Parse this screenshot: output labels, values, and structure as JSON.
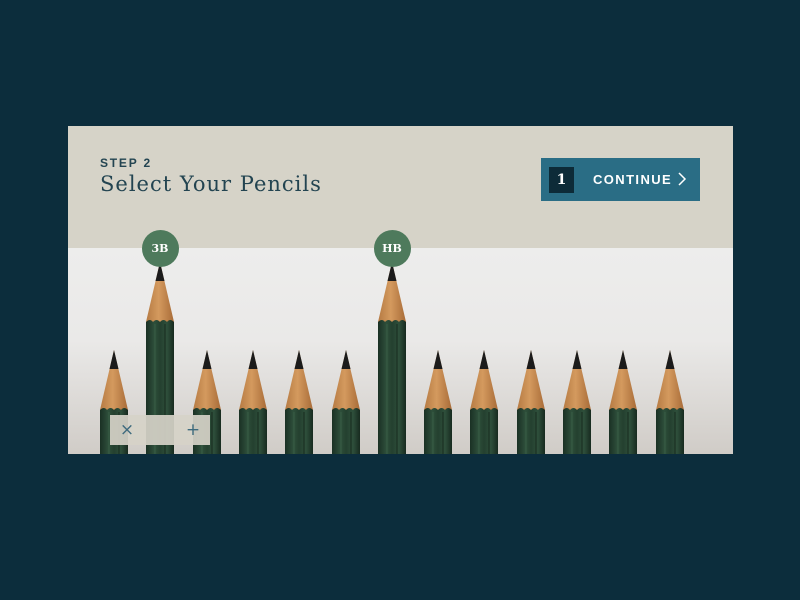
{
  "header": {
    "step_label": "STEP 2",
    "title": "Select Your Pencils",
    "continue_button": {
      "count": "1",
      "label": "CONTINUE",
      "icon": "chevron-right-icon"
    }
  },
  "pencils": [
    {
      "selected": false
    },
    {
      "selected": true,
      "grade": "3B"
    },
    {
      "selected": false
    },
    {
      "selected": false
    },
    {
      "selected": false
    },
    {
      "selected": false
    },
    {
      "selected": true,
      "grade": "HB"
    },
    {
      "selected": false
    },
    {
      "selected": false
    },
    {
      "selected": false
    },
    {
      "selected": false
    },
    {
      "selected": false
    },
    {
      "selected": false
    }
  ],
  "quantity_control": {
    "decrease_symbol": "×",
    "increase_symbol": "+",
    "decrease_icon": "close-icon",
    "increase_icon": "plus-icon"
  },
  "colors": {
    "page_background": "#0c2d3c",
    "header_background": "#d6d3c8",
    "accent": "#2a6d85",
    "badge": "#4e7a5c",
    "pencil_body": "#24402f",
    "pencil_wood": "#d49a5e",
    "text_dark": "#234451"
  }
}
